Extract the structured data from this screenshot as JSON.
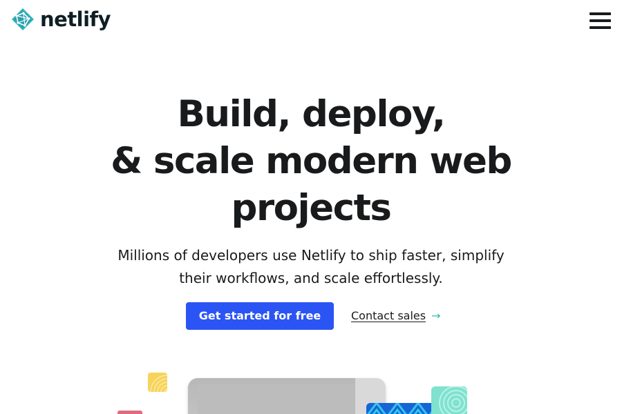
{
  "header": {
    "logo_text": "netlify",
    "logo_icon": "netlify-logo-icon",
    "menu_icon": "hamburger-menu-icon"
  },
  "hero": {
    "title_lines": [
      "Build, deploy,",
      "& scale modern web",
      "projects"
    ],
    "subtitle_lines": [
      "Millions of developers use Netlify to ship faster, simplify",
      "their workflows, and scale effortlessly."
    ],
    "primary_cta": "Get started for free",
    "secondary_cta": "Contact sales",
    "secondary_cta_arrow": "→"
  },
  "colors": {
    "brand_teal": "#32b3b8",
    "primary_button": "#2b54f5",
    "text": "#181a1c",
    "arrow": "#2fb7b7"
  }
}
